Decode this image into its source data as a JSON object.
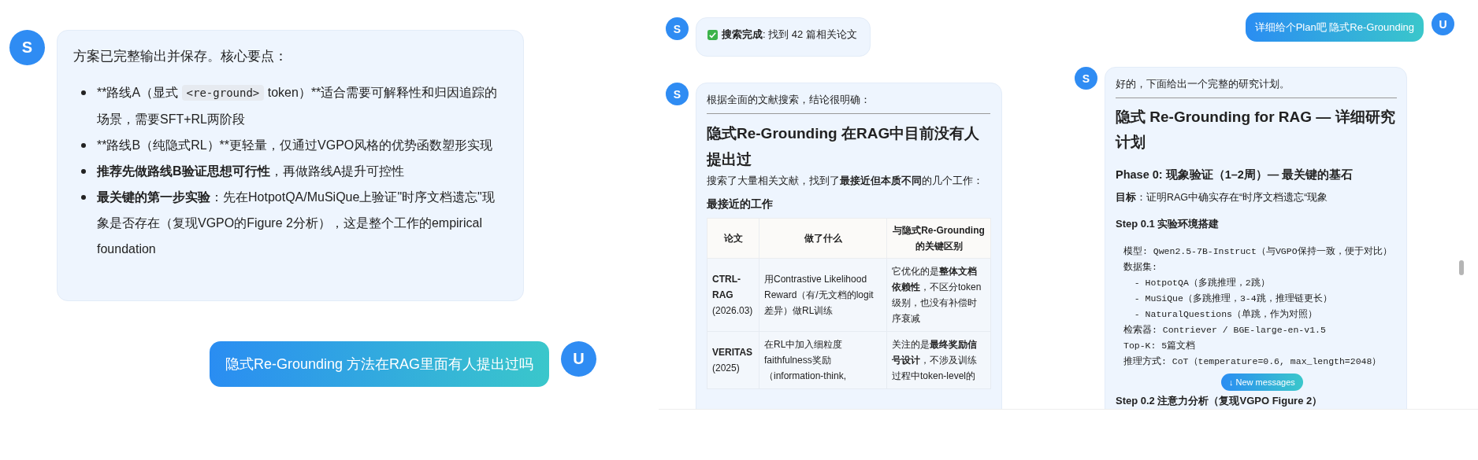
{
  "left": {
    "assistant": {
      "avatar": "S",
      "intro": "方案已完整输出并保存。核心要点：",
      "points": [
        [
          {
            "kind": "plain",
            "text": "**路线A（显式 "
          },
          {
            "kind": "code",
            "text": "<re-ground>"
          },
          {
            "kind": "plain",
            "text": " token）**适合需要可解释性和归因追踪的场景，需要SFT+RL两阶段"
          }
        ],
        [
          {
            "kind": "plain",
            "text": "**路线B（纯隐式RL）**更轻量，仅通过VGPO风格的优势函数塑形实现"
          }
        ],
        [
          {
            "kind": "bold",
            "text": "推荐先做路线B验证思想可行性"
          },
          {
            "kind": "plain",
            "text": "，再做路线A提升可控性"
          }
        ],
        [
          {
            "kind": "bold",
            "text": "最关键的第一步实验"
          },
          {
            "kind": "plain",
            "text": "：先在HotpotQA/MuSiQue上验证\"时序文档遗忘\"现象是否存在（复现VGPO的Figure 2分析），这是整个工作的empirical foundation"
          }
        ]
      ]
    },
    "user": {
      "avatar": "U",
      "text": "隐式Re-Grounding 方法在RAG里面有人提出过吗"
    }
  },
  "middle": {
    "status": {
      "avatar": "S",
      "text": "**搜索完成**: 找到 42 篇相关论文"
    },
    "answer": {
      "avatar": "S",
      "intro": "根据全面的文献搜索，结论很明确：",
      "heading": "隐式Re-Grounding 在RAG中目前没有人提出过",
      "paragraph": "搜索了大量相关文献，找到了**最接近但本质不同**的几个工作：",
      "subheading": "最接近的工作",
      "table": {
        "columns": [
          "论文",
          "做了什么",
          "与隐式Re-Grounding的关键区别"
        ],
        "rows": [
          [
            "**CTRL-RAG** (2026.03)",
            "用Contrastive Likelihood Reward（有/无文档的logit差异）做RL训练",
            "它优化的是**整体文档依赖性**，不区分token级别，也没有补偿时序衰减"
          ],
          [
            "**VERITAS** (2025)",
            "在RL中加入细粒度faithfulness奖励（information-think,",
            "关注的是**最终奖励信号设计**，不涉及训练过程中token-level的"
          ]
        ]
      }
    }
  },
  "right": {
    "user": {
      "avatar": "U",
      "text": "详细给个Plan吧 隐式Re-Grounding"
    },
    "answer": {
      "avatar": "S",
      "intro": "好的，下面给出一个完整的研究计划。",
      "heading": "隐式 Re-Grounding for RAG — 详细研究计划",
      "phase": "Phase 0: 现象验证（1–2周）— 最关键的基石",
      "goal": "**目标**：证明RAG中确实存在“时序文档遗忘“现象",
      "step": "Step 0.1 实验环境搭建",
      "code_lines": [
        "模型: Qwen2.5-7B-Instruct（与VGPO保持一致，便于对比）",
        "数据集:",
        "  - HotpotQA（多跳推理，2跳）",
        "  - MuSiQue（多跳推理，3-4跳，推理链更长）",
        "  - NaturalQuestions（单跳，作为对照）",
        "检索器: Contriever / BGE-large-en-v1.5",
        "Top-K: 5篇文档",
        "推理方式: CoT（temperature=0.6, max_length=2048）"
      ],
      "next_step": "Step 0.2 注意力分析（复现VGPO Figure 2）"
    },
    "new_messages_button": "↓ New messages"
  }
}
